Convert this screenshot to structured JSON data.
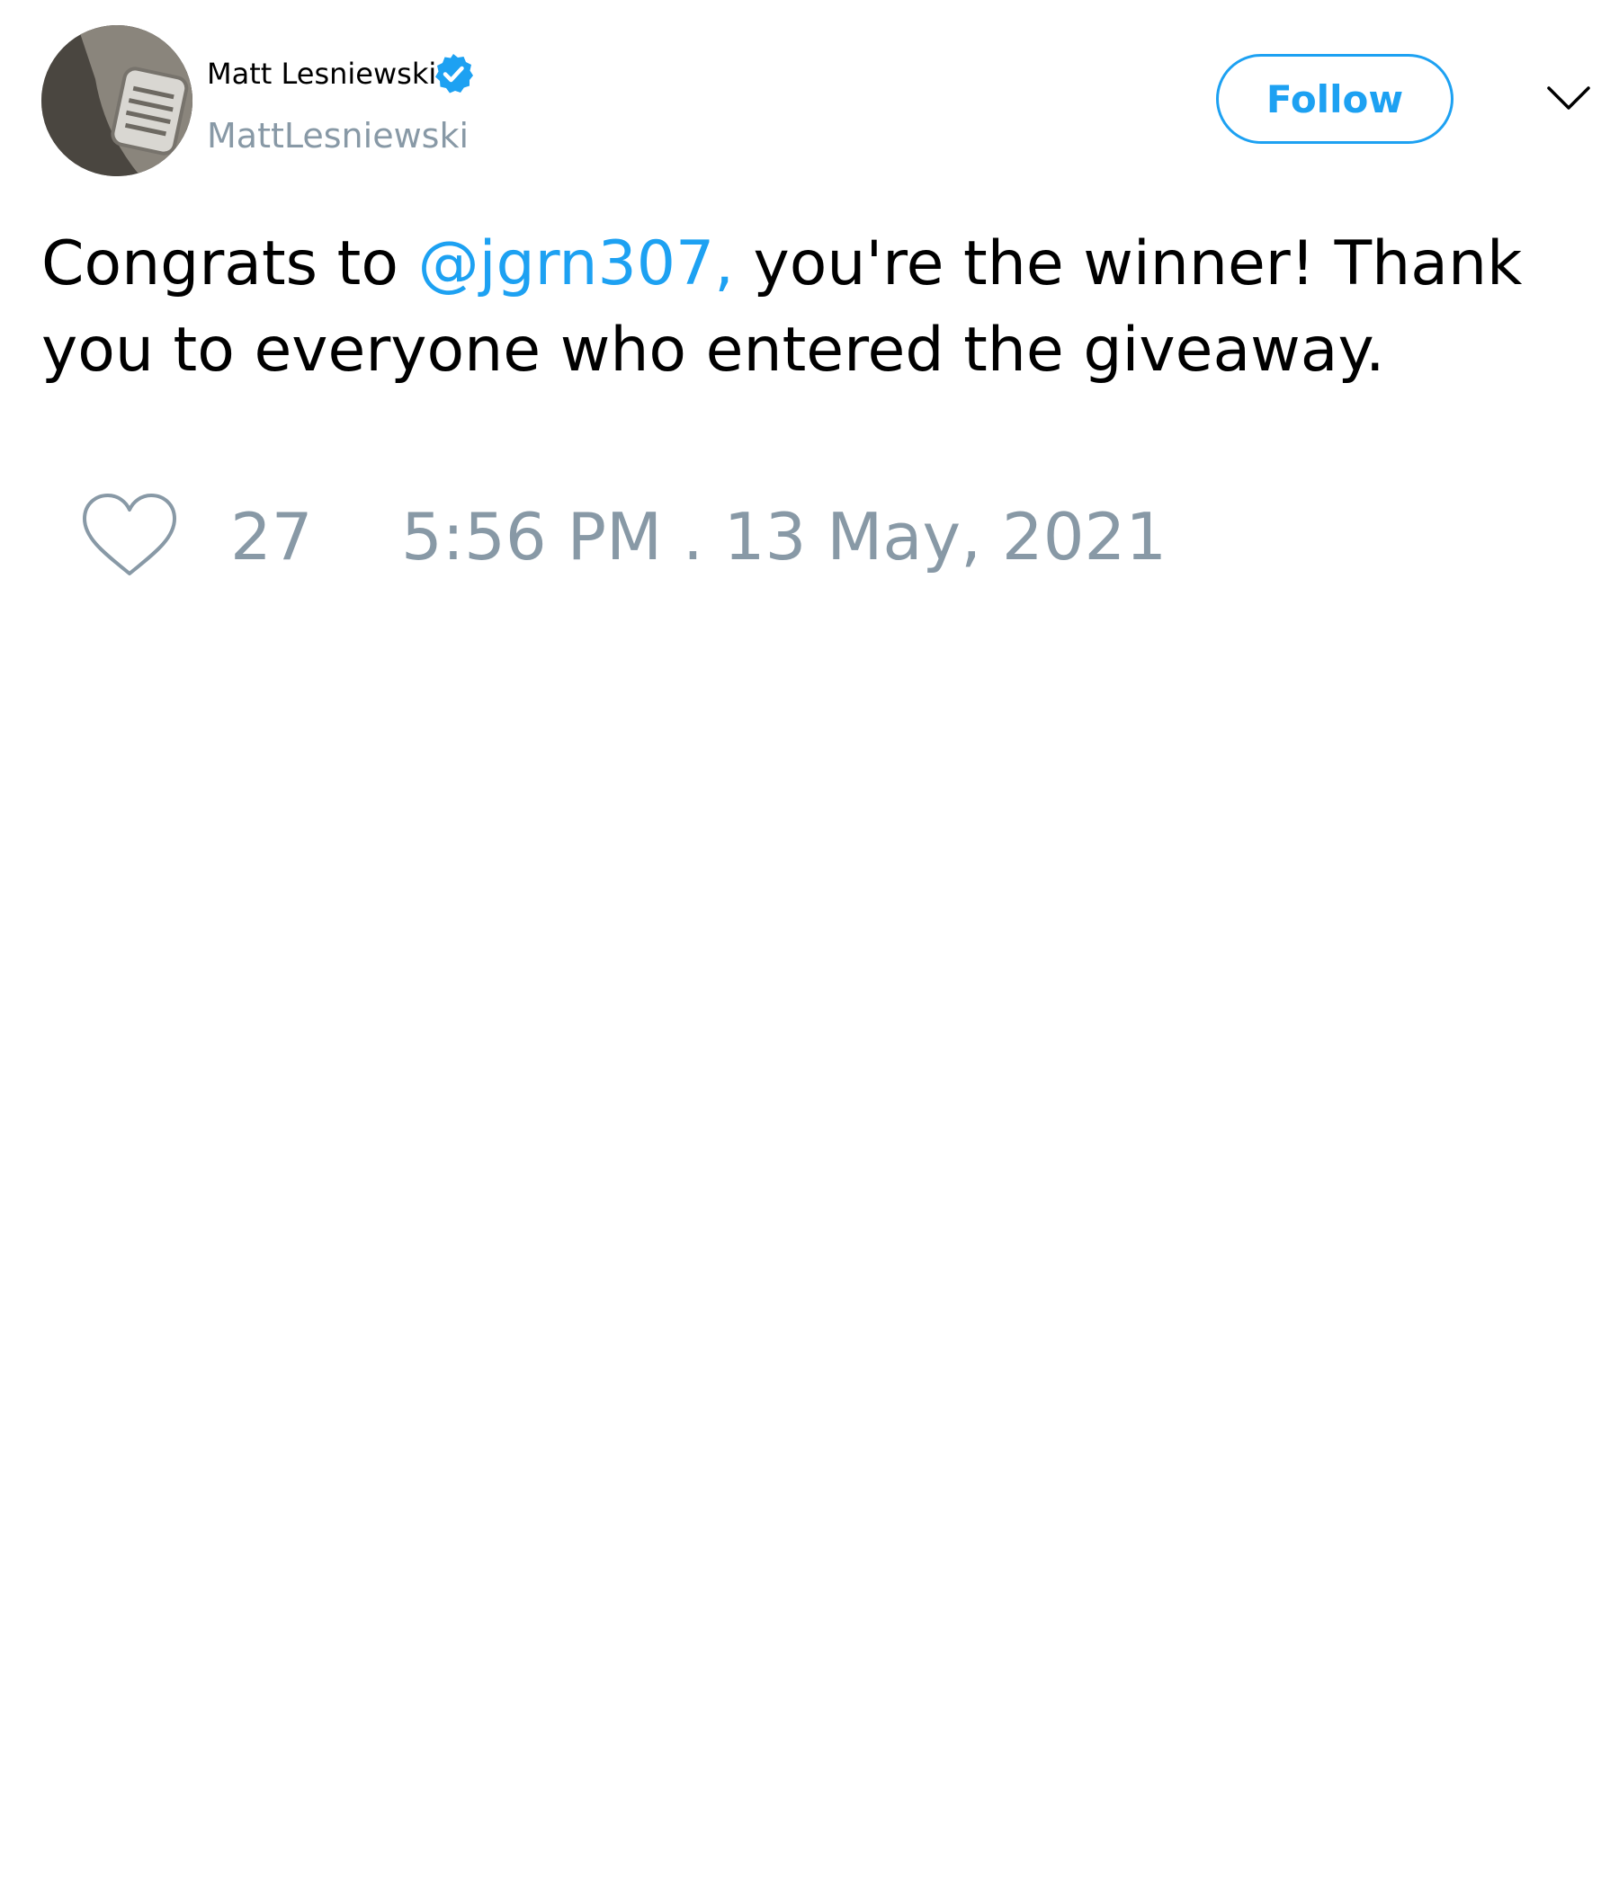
{
  "author": {
    "name": "Matt Lesniewski",
    "handle": "MattLesniewski",
    "verified": true
  },
  "follow_button": {
    "label": "Follow"
  },
  "tweet": {
    "text_before": "Congrats to ",
    "mention": "@jgrn307,",
    "text_after": " you're the winner! Thank you to everyone who entered the giveaway."
  },
  "meta": {
    "like_count": "27",
    "timestamp": "5:56 PM . 13 May, 2021"
  },
  "colors": {
    "accent": "#1da1f2",
    "muted": "#8899a6",
    "text": "#000000",
    "background": "#ffffff"
  },
  "icons": {
    "verified": "verified-badge-icon",
    "caret": "chevron-down-icon",
    "like": "heart-icon"
  }
}
